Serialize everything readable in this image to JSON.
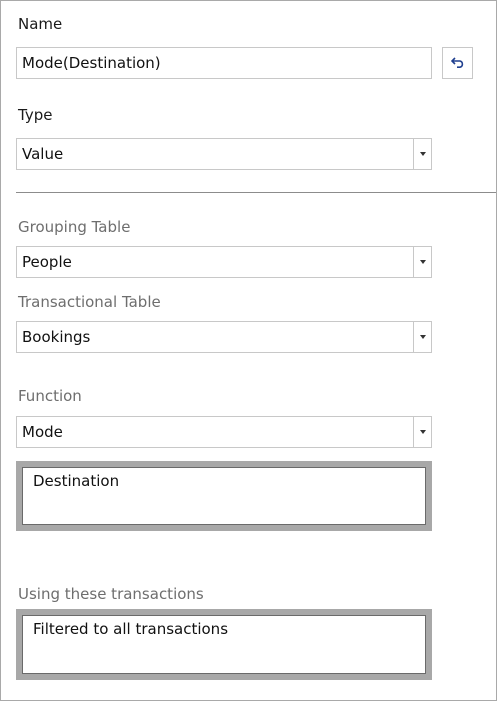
{
  "name_section": {
    "label": "Name",
    "value": "Mode(Destination)",
    "undo_icon": "undo-icon"
  },
  "type_section": {
    "label": "Type",
    "selected": "Value"
  },
  "grouping_table": {
    "label": "Grouping Table",
    "selected": "People"
  },
  "transactional_table": {
    "label": "Transactional Table",
    "selected": "Bookings"
  },
  "function_section": {
    "label": "Function",
    "selected": "Mode",
    "field": "Destination"
  },
  "transactions_section": {
    "label": "Using these transactions",
    "filter_text": "Filtered to all transactions"
  }
}
